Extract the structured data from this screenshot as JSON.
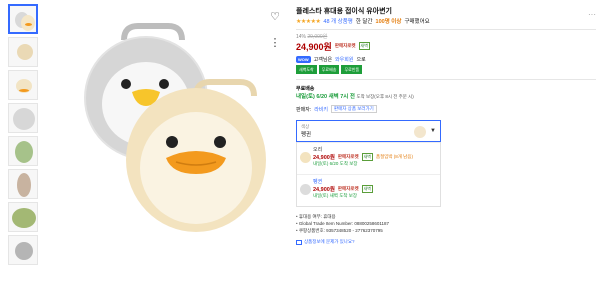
{
  "product": {
    "title": "플레스타 휴대용 접이식 유아변기",
    "stars": "★★★★★",
    "rating_count": "48 개 상품평",
    "social_proof_prefix": "한 달간",
    "social_proof_count": "100명 이상",
    "social_proof_suffix": "구매했어요"
  },
  "pricing": {
    "discount_rate": "14%",
    "original_price": "29,000원",
    "price": "24,900원",
    "rocket_label": "판매자로켓",
    "rocket_badge": "새벽"
  },
  "wow": {
    "badge": "WOW",
    "text": "고객님은",
    "link": "와우회원",
    "suffix": "으로",
    "benefits": [
      "새벽도착",
      "무료배송",
      "무료반품"
    ]
  },
  "shipping": {
    "label": "무료배송",
    "date": "내일(토) 6/20 새벽 7시 전",
    "note": "도착 보장(오후 8시 전 주문 시)"
  },
  "seller": {
    "label": "판매자:",
    "name": "라비키",
    "other_button": "판매자 상품 보러가기"
  },
  "option_select": {
    "label": "색상",
    "value": "펭귄",
    "caret": "▼"
  },
  "options": [
    {
      "name": "오리",
      "price": "24,900원",
      "rocket": "판매자로켓",
      "badge": "새벽",
      "note": "품절임박 (8개 남음)",
      "delivery": "내일(토) 6/20 도착 보장"
    },
    {
      "name": "펭귄",
      "price": "24,900원",
      "rocket": "판매자로켓",
      "badge": "새벽",
      "note": "",
      "delivery": "내일(토) 새벽 도착 보장"
    }
  ],
  "details": [
    "휴대용 여부: 휴대용",
    "Global Trade Item Number: 08800258601187",
    "쿠팡상품번호: 9357348520 - 27762370795"
  ],
  "report_link": "상품정보에 문제가 있나요?",
  "icons": {
    "heart": "♡",
    "share": "⋮",
    "more": "···"
  }
}
